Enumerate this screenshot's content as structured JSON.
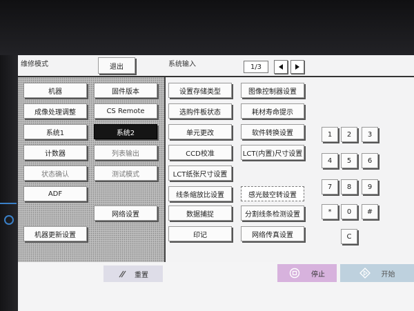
{
  "header": {
    "title": "维修模式",
    "exit_label": "退出",
    "section_title": "系统输入",
    "page_indicator": "1/3"
  },
  "left_buttons": [
    {
      "label": "机器"
    },
    {
      "label": "固件版本"
    },
    {
      "label": "成像处理调整"
    },
    {
      "label": "CS Remote"
    },
    {
      "label": "系统1"
    },
    {
      "label": "系统2"
    },
    {
      "label": "计数器"
    },
    {
      "label": "列表输出"
    },
    {
      "label": "状态确认"
    },
    {
      "label": "测试模式"
    },
    {
      "label": "ADF"
    },
    {
      "label": "网络设置"
    },
    {
      "label": "机器更新设置"
    }
  ],
  "selected_left": "系统2",
  "menu_buttons": [
    {
      "label": "设置存储类型"
    },
    {
      "label": "图像控制器设置"
    },
    {
      "label": "选购件板状态"
    },
    {
      "label": "耗材寿命提示"
    },
    {
      "label": "单元更改"
    },
    {
      "label": "软件转换设置"
    },
    {
      "label": "CCD校准"
    },
    {
      "label": "LCT(内置)尺寸设置"
    },
    {
      "label": "LCT纸张尺寸设置"
    },
    {
      "label": "线条缩放比设置"
    },
    {
      "label": "感光鼓空转设置"
    },
    {
      "label": "数据捕捉"
    },
    {
      "label": "分割线条检测设置"
    },
    {
      "label": "印记"
    },
    {
      "label": "网络传真设置"
    }
  ],
  "keypad": [
    "1",
    "2",
    "3",
    "4",
    "5",
    "6",
    "7",
    "8",
    "9",
    "*",
    "0",
    "#",
    "C"
  ],
  "footer": {
    "reset_label": "重置",
    "stop_label": "停止",
    "start_label": "开始"
  },
  "colors": {
    "stop_button": "#d7b2dd",
    "start_button": "#bed1de",
    "reset_button": "#dedde8",
    "selected_button": "#151515"
  }
}
